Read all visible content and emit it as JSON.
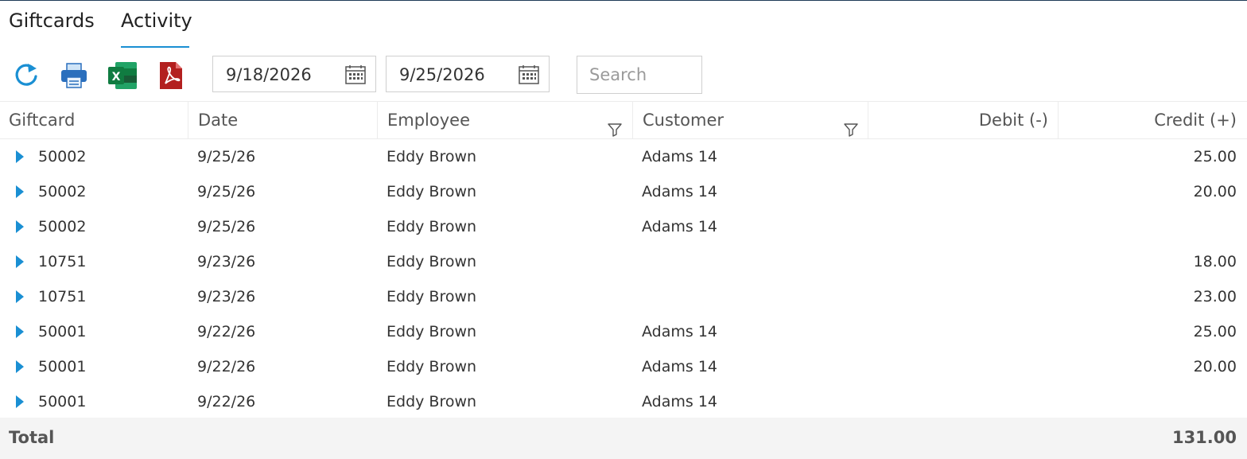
{
  "tabs": [
    {
      "label": "Giftcards",
      "active": false
    },
    {
      "label": "Activity",
      "active": true
    }
  ],
  "toolbar": {
    "refresh_icon": "refresh-icon",
    "print_icon": "printer-icon",
    "excel_icon": "excel-icon",
    "pdf_icon": "pdf-icon",
    "date_from": "9/18/2026",
    "date_to": "9/25/2026",
    "search_placeholder": "Search"
  },
  "columns": [
    "Giftcard",
    "Date",
    "Employee",
    "Customer",
    "Debit (-)",
    "Credit (+)"
  ],
  "rows": [
    {
      "giftcard": "50002",
      "date": "9/25/26",
      "employee": "Eddy Brown",
      "customer": "Adams 14",
      "debit": "",
      "credit": "25.00"
    },
    {
      "giftcard": "50002",
      "date": "9/25/26",
      "employee": "Eddy Brown",
      "customer": "Adams 14",
      "debit": "",
      "credit": "20.00"
    },
    {
      "giftcard": "50002",
      "date": "9/25/26",
      "employee": "Eddy Brown",
      "customer": "Adams 14",
      "debit": "",
      "credit": ""
    },
    {
      "giftcard": "10751",
      "date": "9/23/26",
      "employee": "Eddy Brown",
      "customer": "",
      "debit": "",
      "credit": "18.00"
    },
    {
      "giftcard": "10751",
      "date": "9/23/26",
      "employee": "Eddy Brown",
      "customer": "",
      "debit": "",
      "credit": "23.00"
    },
    {
      "giftcard": "50001",
      "date": "9/22/26",
      "employee": "Eddy Brown",
      "customer": "Adams 14",
      "debit": "",
      "credit": "25.00"
    },
    {
      "giftcard": "50001",
      "date": "9/22/26",
      "employee": "Eddy Brown",
      "customer": "Adams 14",
      "debit": "",
      "credit": "20.00"
    },
    {
      "giftcard": "50001",
      "date": "9/22/26",
      "employee": "Eddy Brown",
      "customer": "Adams 14",
      "debit": "",
      "credit": ""
    }
  ],
  "footer": {
    "label": "Total",
    "credit_total": "131.00"
  },
  "colors": {
    "accent": "#1a8fd3",
    "expander": "#1a8fd3",
    "excel": "#1e7145",
    "pdf": "#b3201f",
    "printer": "#2a6fbd"
  }
}
